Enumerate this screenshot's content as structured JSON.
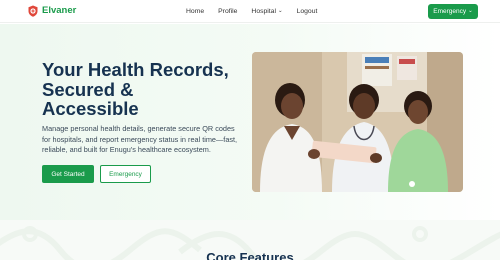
{
  "brand": {
    "name": "Elvaner",
    "accent": "#1a9b4b"
  },
  "nav": {
    "links": [
      {
        "label": "Home"
      },
      {
        "label": "Profile"
      },
      {
        "label": "Hospital",
        "icon": "chevron-down-icon"
      },
      {
        "label": "Logout"
      }
    ],
    "cta_label": "Emergency",
    "cta_icon": "chevron-down-icon"
  },
  "hero": {
    "title": "Your Health Records,\nSecured &\nAccessible",
    "subtitle": "Manage personal health details, generate secure QR codes for hospitals, and report emergency status in real time—fast, reliable, and built for Enugu's healthcare ecosystem.",
    "primary_button": "Get Started",
    "secondary_button": "Emergency",
    "image_subject": "three smiling nurses in uniforms looking at a clipboard"
  },
  "section": {
    "title": "Core Features"
  },
  "colors": {
    "primary": "#1a9b4b",
    "heading": "#163250",
    "hero_bg": "#eef8f0"
  }
}
